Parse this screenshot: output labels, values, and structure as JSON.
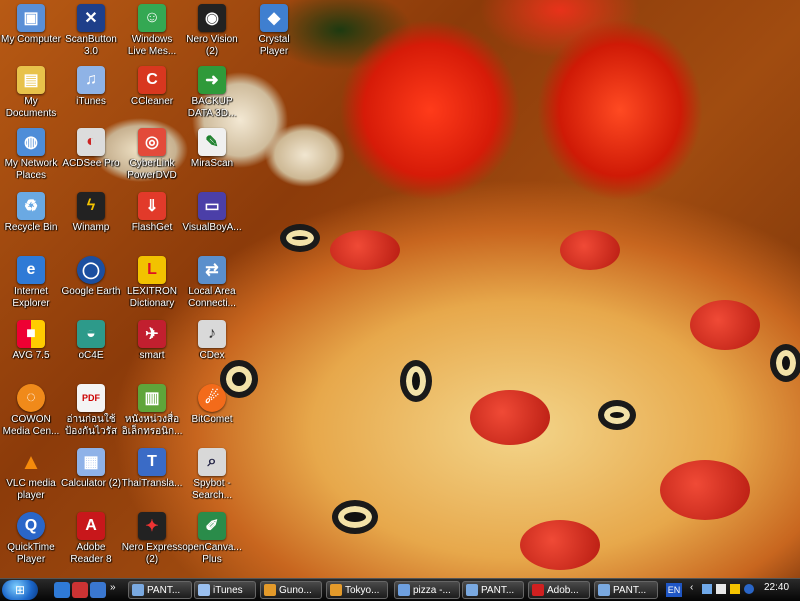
{
  "desktop": {
    "icons": [
      {
        "label": "My Computer"
      },
      {
        "label": "ScanButton\n3.0"
      },
      {
        "label": "Windows\nLive Mes..."
      },
      {
        "label": "Nero Vision\n(2)"
      },
      {
        "label": "Crystal Player"
      },
      {
        "label": "My\nDocuments"
      },
      {
        "label": "iTunes"
      },
      {
        "label": "CCleaner"
      },
      {
        "label": "BACKUP\nDATA 3D..."
      },
      {
        "label": "My Network\nPlaces"
      },
      {
        "label": "ACDSee Pro"
      },
      {
        "label": "CyberLink\nPowerDVD"
      },
      {
        "label": "MiraScan"
      },
      {
        "label": "Recycle Bin"
      },
      {
        "label": "Winamp"
      },
      {
        "label": "FlashGet"
      },
      {
        "label": "VisualBoyA..."
      },
      {
        "label": "Internet\nExplorer"
      },
      {
        "label": "Google Earth"
      },
      {
        "label": "LEXITRON\nDictionary"
      },
      {
        "label": "Local Area\nConnecti..."
      },
      {
        "label": "AVG 7.5"
      },
      {
        "label": "oC4E"
      },
      {
        "label": "smart"
      },
      {
        "label": "CDex"
      },
      {
        "label": "COWON\nMedia Cen..."
      },
      {
        "label": "อ่านก่อนใช้\nป้องกันไวรัส"
      },
      {
        "label": "หนังหน่วงสื่อ\nอิเล็กทรอนิก..."
      },
      {
        "label": "BitComet"
      },
      {
        "label": "VLC media\nplayer"
      },
      {
        "label": "Calculator (2)"
      },
      {
        "label": "ThaiTransla..."
      },
      {
        "label": "Spybot -\nSearch..."
      },
      {
        "label": "QuickTime\nPlayer"
      },
      {
        "label": "Adobe\nReader 8"
      },
      {
        "label": "Nero Express\n(2)"
      },
      {
        "label": "openCanva...\nPlus"
      }
    ]
  },
  "taskbar": {
    "buttons": [
      {
        "label": "PANT..."
      },
      {
        "label": "iTunes"
      },
      {
        "label": "Guno..."
      },
      {
        "label": "Tokyo..."
      },
      {
        "label": "pizza -..."
      },
      {
        "label": "PANT..."
      },
      {
        "label": "Adob..."
      },
      {
        "label": "PANT..."
      }
    ],
    "language": "EN",
    "clock": "22:40"
  },
  "colors": {
    "taskbar_bg": "#111111",
    "accent": "#1b66c9"
  }
}
